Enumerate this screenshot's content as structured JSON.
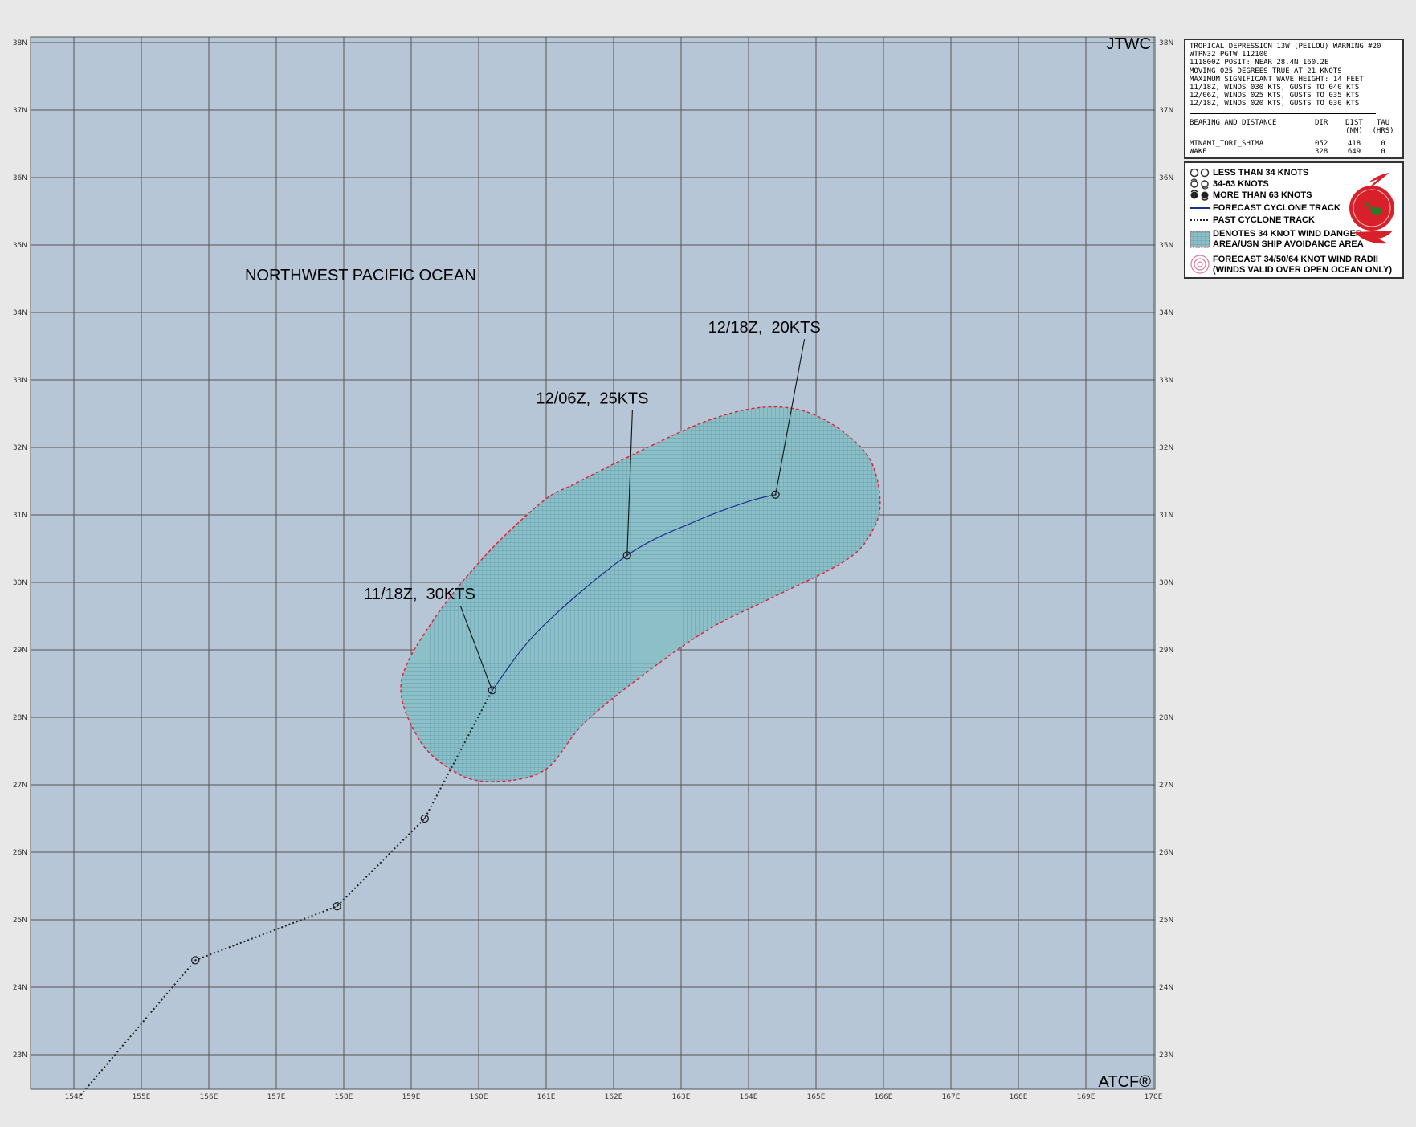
{
  "map": {
    "region_label": "NORTHWEST PACIFIC OCEAN",
    "corner_top": "JTWC",
    "corner_bottom": "ATCF®",
    "lat_labels": [
      "38N",
      "37N",
      "36N",
      "35N",
      "34N",
      "33N",
      "32N",
      "31N",
      "30N",
      "29N",
      "28N",
      "27N",
      "26N",
      "25N",
      "24N",
      "23N"
    ],
    "lon_labels": [
      "154E",
      "155E",
      "156E",
      "157E",
      "158E",
      "159E",
      "160E",
      "161E",
      "162E",
      "163E",
      "164E",
      "165E",
      "166E",
      "167E",
      "168E",
      "169E",
      "170E"
    ],
    "forecast_labels": [
      {
        "text": "11/18Z,  30KTS",
        "lat": 28.4,
        "lon": 160.2,
        "label_lat": 29.75,
        "label_lon": 158.3
      },
      {
        "text": "12/06Z,  25KTS",
        "lat": 30.4,
        "lon": 162.2,
        "label_lat": 32.65,
        "label_lon": 160.85
      },
      {
        "text": "12/18Z,  20KTS",
        "lat": 31.3,
        "lon": 164.4,
        "label_lat": 33.7,
        "label_lon": 163.4
      }
    ],
    "past_track": [
      {
        "lat": 22.4,
        "lon": 154.1,
        "circle": false
      },
      {
        "lat": 24.4,
        "lon": 155.8,
        "circle": true
      },
      {
        "lat": 25.2,
        "lon": 157.9,
        "circle": true
      },
      {
        "lat": 26.5,
        "lon": 159.2,
        "circle": true
      },
      {
        "lat": 28.4,
        "lon": 160.2,
        "circle": false
      }
    ],
    "forecast_track": [
      {
        "lat": 28.4,
        "lon": 160.2
      },
      {
        "lat": 29.3,
        "lon": 160.9
      },
      {
        "lat": 30.4,
        "lon": 162.2
      },
      {
        "lat": 30.9,
        "lon": 163.2
      },
      {
        "lat": 31.2,
        "lon": 164.0
      },
      {
        "lat": 31.3,
        "lon": 164.4
      }
    ],
    "danger_area": [
      {
        "lat": 27.05,
        "lon": 160.1
      },
      {
        "lat": 27.2,
        "lon": 160.95
      },
      {
        "lat": 27.9,
        "lon": 161.55
      },
      {
        "lat": 28.6,
        "lon": 162.4
      },
      {
        "lat": 29.3,
        "lon": 163.4
      },
      {
        "lat": 29.75,
        "lon": 164.3
      },
      {
        "lat": 30.3,
        "lon": 165.4
      },
      {
        "lat": 30.7,
        "lon": 165.8
      },
      {
        "lat": 31.2,
        "lon": 165.95
      },
      {
        "lat": 31.9,
        "lon": 165.75
      },
      {
        "lat": 32.45,
        "lon": 165.05
      },
      {
        "lat": 32.6,
        "lon": 164.3
      },
      {
        "lat": 32.4,
        "lon": 163.4
      },
      {
        "lat": 31.9,
        "lon": 162.3
      },
      {
        "lat": 31.45,
        "lon": 161.4
      },
      {
        "lat": 31.2,
        "lon": 160.95
      },
      {
        "lat": 30.4,
        "lon": 160.1
      },
      {
        "lat": 29.4,
        "lon": 159.3
      },
      {
        "lat": 28.5,
        "lon": 158.85
      },
      {
        "lat": 27.7,
        "lon": 159.1
      },
      {
        "lat": 27.25,
        "lon": 159.55
      }
    ],
    "colors": {
      "ocean": "#b7c6d6",
      "grid": "#545454",
      "danger_fill": "#8dbfc9",
      "danger_edge": "#e0202e",
      "forecast_track": "#1f2f8f",
      "past_track": "#222222"
    }
  },
  "info": {
    "lines": [
      "TROPICAL DEPRESSION 13W (PEILOU) WARNING #20",
      "WTPN32 PGTW 112100",
      "111800Z POSIT: NEAR 28.4N 160.2E",
      "MOVING 025 DEGREES TRUE AT 21 KNOTS",
      "MAXIMUM SIGNIFICANT WAVE HEIGHT: 14 FEET",
      "11/18Z, WINDS 030 KTS, GUSTS TO 040 KTS",
      "12/06Z, WINDS 025 KTS, GUSTS TO 035 KTS",
      "12/18Z, WINDS 020 KTS, GUSTS TO 030 KTS"
    ],
    "bearing_header": {
      "c1": "BEARING AND DISTANCE",
      "c2": "DIR",
      "c3": "DIST",
      "c4": "TAU"
    },
    "bearing_units": {
      "c3": "(NM)",
      "c4": "(HRS)"
    },
    "rows": [
      {
        "name": "MINAMI_TORI_SHIMA",
        "dir": "052",
        "dist": "418",
        "tau": "0"
      },
      {
        "name": "WAKE",
        "dir": "328",
        "dist": "649",
        "tau": "0"
      }
    ]
  },
  "legend": {
    "items": [
      "LESS THAN 34 KNOTS",
      "34-63 KNOTS",
      "MORE THAN 63 KNOTS",
      "FORECAST CYCLONE TRACK",
      "PAST CYCLONE TRACK",
      "DENOTES 34 KNOT WIND DANGER",
      "AREA/USN SHIP AVOIDANCE AREA",
      "FORECAST 34/50/64 KNOT WIND RADII",
      "(WINDS VALID OVER OPEN OCEAN ONLY)"
    ]
  }
}
